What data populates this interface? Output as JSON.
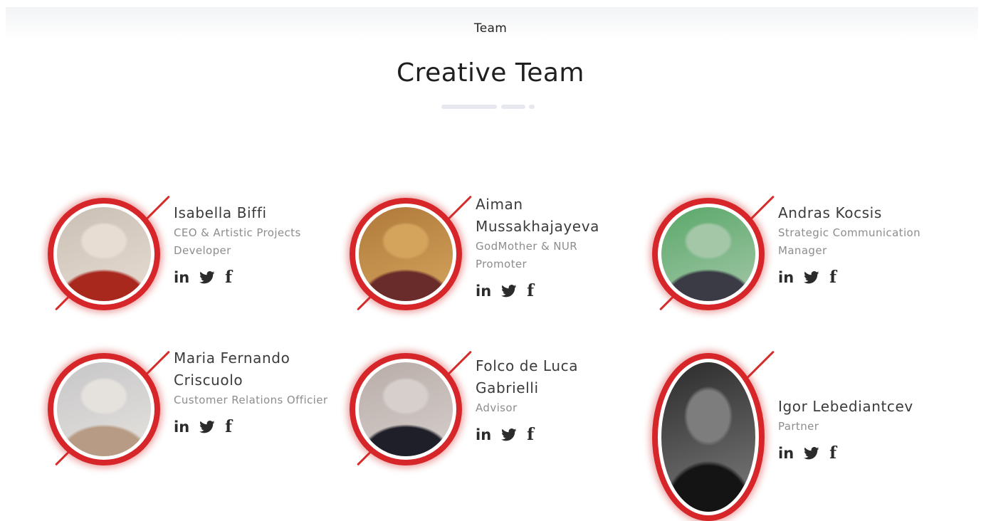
{
  "header": {
    "eyebrow": "Team",
    "title": "Creative Team"
  },
  "social_labels": {
    "linkedin": "in",
    "facebook": "f"
  },
  "members": [
    {
      "name": "Isabella Biffi",
      "role": "CEO & Artistic Projects Developer",
      "photo_colors": [
        "#c9bfb4",
        "#e8ddd2",
        "#a8281e"
      ]
    },
    {
      "name": "Aiman Mussakhajayeva",
      "role": "GodMother & NUR Promoter",
      "photo_colors": [
        "#b07a3a",
        "#d4a45d",
        "#6a2b2b"
      ]
    },
    {
      "name": "Andras Kocsis",
      "role": "Strategic Communication Manager",
      "photo_colors": [
        "#5aa86a",
        "#a4c7a8",
        "#3b3b45"
      ]
    },
    {
      "name": "Maria Fernando Criscuolo",
      "role": "Customer Relations Officier",
      "photo_colors": [
        "#c7c6c8",
        "#e5e2de",
        "#b79b84"
      ]
    },
    {
      "name": "Folco de Luca Gabrielli",
      "role": "Advisor",
      "photo_colors": [
        "#b8aca8",
        "#d6cfcc",
        "#1e1f29"
      ]
    },
    {
      "name": "Igor Lebediantcev",
      "role": "Partner",
      "photo_colors": [
        "#2b2b2b",
        "#7d7d7d",
        "#141414"
      ]
    }
  ]
}
